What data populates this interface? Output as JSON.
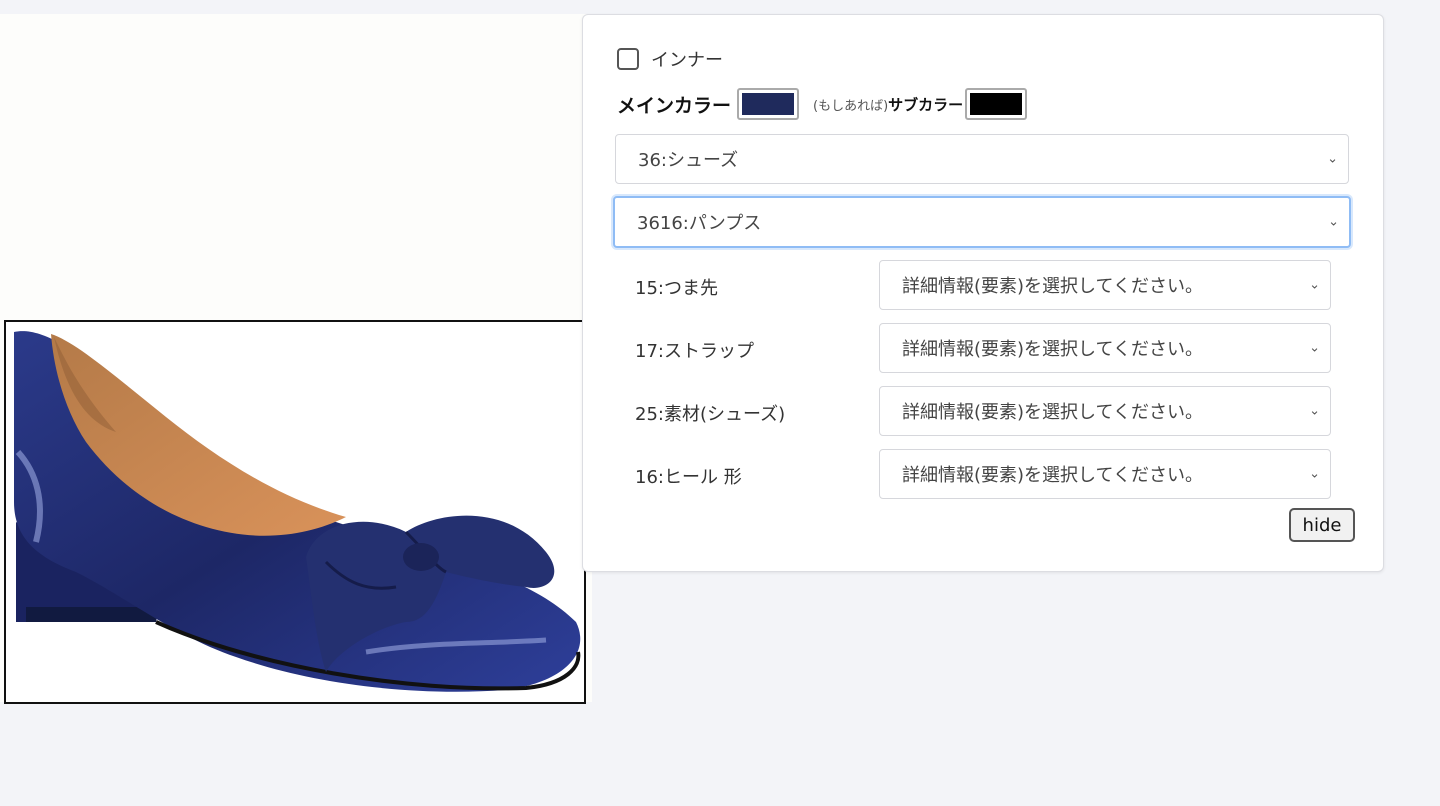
{
  "image": {
    "subject": "navy-patent-pump-with-bow"
  },
  "panel": {
    "inner_checkbox_label": "インナー",
    "inner_checked": false,
    "main_color_label": "メインカラー",
    "main_color": "#1f2a5c",
    "sub_color_note": "(もしあれば)",
    "sub_color_label": "サブカラー",
    "sub_color": "#000000",
    "category_select": "36:シューズ",
    "subcategory_select": "3616:パンプス",
    "attributes": [
      {
        "label": "15:つま先",
        "value": "詳細情報(要素)を選択してください。"
      },
      {
        "label": "17:ストラップ",
        "value": "詳細情報(要素)を選択してください。"
      },
      {
        "label": "25:素材(シューズ)",
        "value": "詳細情報(要素)を選択してください。"
      },
      {
        "label": "16:ヒール 形",
        "value": "詳細情報(要素)を選択してください。"
      }
    ],
    "hide_button": "hide"
  },
  "colors": {
    "background": "#f3f4f8",
    "focus_border": "#8fbcf5"
  }
}
